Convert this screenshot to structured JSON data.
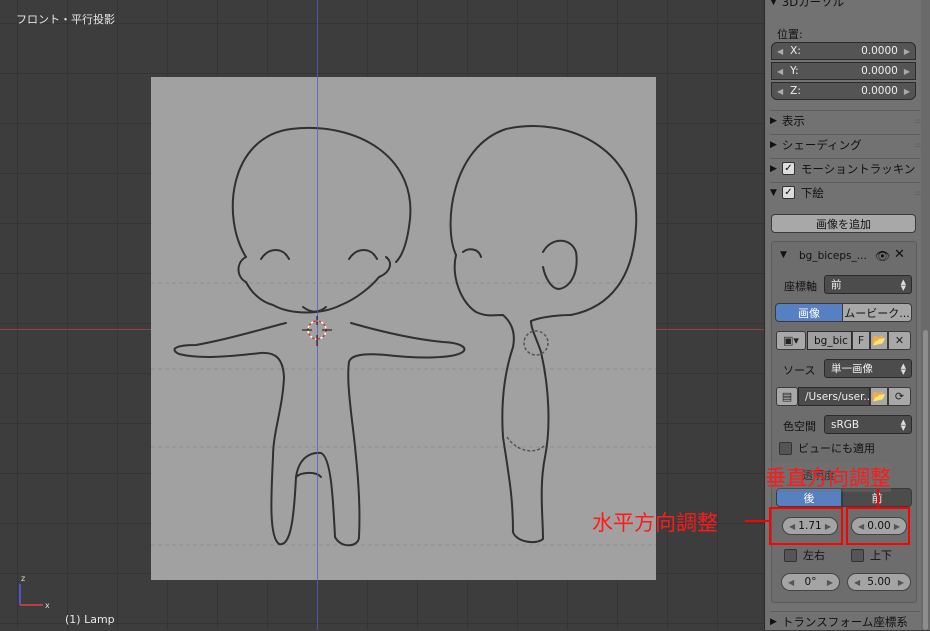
{
  "viewport": {
    "title": "フロント・平行投影",
    "object_label": "(1) Lamp"
  },
  "panel": {
    "cursor_header": "3Dカーソル",
    "position_label": "位置:",
    "location": [
      {
        "axis": "X:",
        "value": "0.0000"
      },
      {
        "axis": "Y:",
        "value": "0.0000"
      },
      {
        "axis": "Z:",
        "value": "0.0000"
      }
    ],
    "sections": {
      "display": "表示",
      "shading": "シェーディング",
      "motion_tracking": "モーショントラッキン",
      "background_images": "下絵",
      "transform_orientation": "トランスフォーム座標系"
    },
    "add_image_button": "画像を追加",
    "bg_entry": {
      "name": "bg_biceps_...",
      "axis_label": "座標軸",
      "axis_value": "前",
      "tab_image": "画像",
      "tab_movie": "ムービーク...",
      "image_name": "bg_bic",
      "fake_user": "F",
      "source_label": "ソース",
      "source_value": "単一画像",
      "filepath": "/Users/user...",
      "colorspace_label": "色空間",
      "colorspace_value": "sRGB",
      "view_as_render_label": "ビューにも適用",
      "opacity_label": "透明度",
      "back_label": "後",
      "front_label": "前",
      "offset_x": "1.71",
      "offset_y": "0.00",
      "flip_x_label": "左右",
      "flip_y_label": "上下",
      "rotation": "0°",
      "size": "5.00"
    }
  },
  "annotations": {
    "horizontal": "水平方向調整",
    "vertical": "垂直方向調整",
    "color": "#ff0000"
  }
}
